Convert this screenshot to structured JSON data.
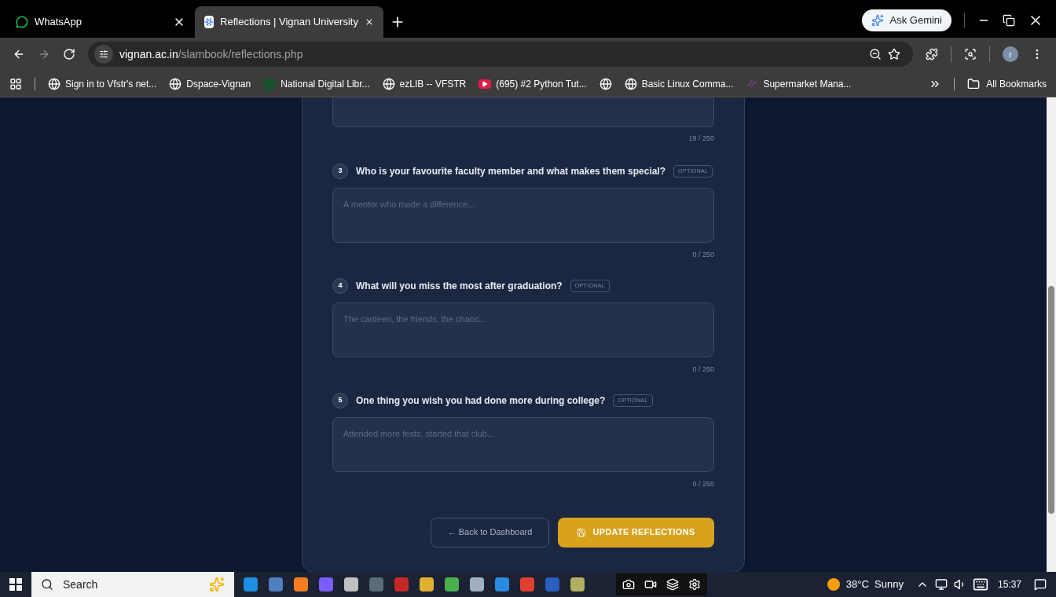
{
  "browser": {
    "tabs": [
      {
        "title": "WhatsApp",
        "selected": false,
        "kind": "chat"
      },
      {
        "title": "Reflections | Vignan University",
        "selected": true,
        "kind": "snowflake"
      }
    ],
    "ask_gemini": "Ask Gemini",
    "address": {
      "host": "vignan.ac.in",
      "path": "/slambook/reflections.php"
    },
    "profile": "r",
    "bookmarks": [
      {
        "label": "Sign in to Vfstr's net...",
        "kind": "globe"
      },
      {
        "label": "Dspace-Vignan",
        "kind": "globe"
      },
      {
        "label": "National Digital Libr...",
        "kind": "dot"
      },
      {
        "label": "ezLIB -- VFSTR",
        "kind": "globe"
      },
      {
        "label": "(695) #2 Python Tut...",
        "kind": "play"
      },
      {
        "kind": "globe"
      },
      {
        "label": "Basic Linux Comma...",
        "kind": "globe"
      },
      {
        "label": "Supermarket Mana...",
        "kind": "arrows"
      }
    ],
    "all_bookmarks": "All Bookmarks"
  },
  "form": {
    "previous_counter": "19 / 250",
    "questions": [
      {
        "number": "3",
        "text": "Who is your favourite faculty member and what makes them special?",
        "badge": "OPTIONAL",
        "placeholder": "A mentor who made a difference...",
        "counter": "0 / 250"
      },
      {
        "number": "4",
        "text": "What will you miss the most after graduation?",
        "badge": "OPTIONAL",
        "placeholder": "The canteen, the friends, the chaos...",
        "counter": "0 / 250"
      },
      {
        "number": "5",
        "text": "One thing you wish you had done more during college?",
        "badge": "OPTIONAL",
        "placeholder": "Attended more fests, started that club...",
        "counter": "0 / 250"
      }
    ],
    "back_button": "← Back to Dashboard",
    "submit_button": "UPDATE REFLECTIONS"
  },
  "taskbar": {
    "search_placeholder": "Search",
    "weather": "38°C  Sunny",
    "time": "15:37"
  }
}
